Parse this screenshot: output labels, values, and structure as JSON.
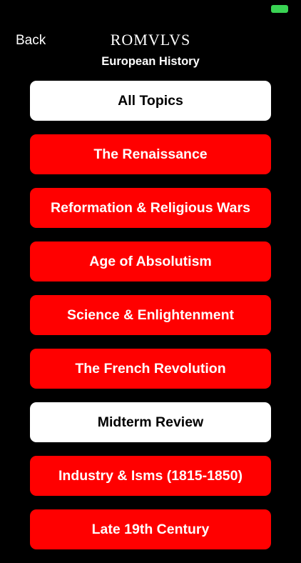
{
  "status": {
    "battery_color": "#39d353"
  },
  "nav": {
    "back_label": "Back",
    "logo_text": "ROMVLVS",
    "title": "European History"
  },
  "topics": [
    {
      "label": "All Topics",
      "style": "white"
    },
    {
      "label": "The Renaissance",
      "style": "red"
    },
    {
      "label": "Reformation & Religious Wars",
      "style": "red"
    },
    {
      "label": "Age of Absolutism",
      "style": "red"
    },
    {
      "label": "Science & Enlightenment",
      "style": "red"
    },
    {
      "label": "The French Revolution",
      "style": "red"
    },
    {
      "label": "Midterm Review",
      "style": "white"
    },
    {
      "label": "Industry & Isms (1815-1850)",
      "style": "red"
    },
    {
      "label": "Late 19th Century",
      "style": "red"
    }
  ],
  "colors": {
    "background": "#000000",
    "accent_red": "#ff0000",
    "white": "#ffffff"
  }
}
